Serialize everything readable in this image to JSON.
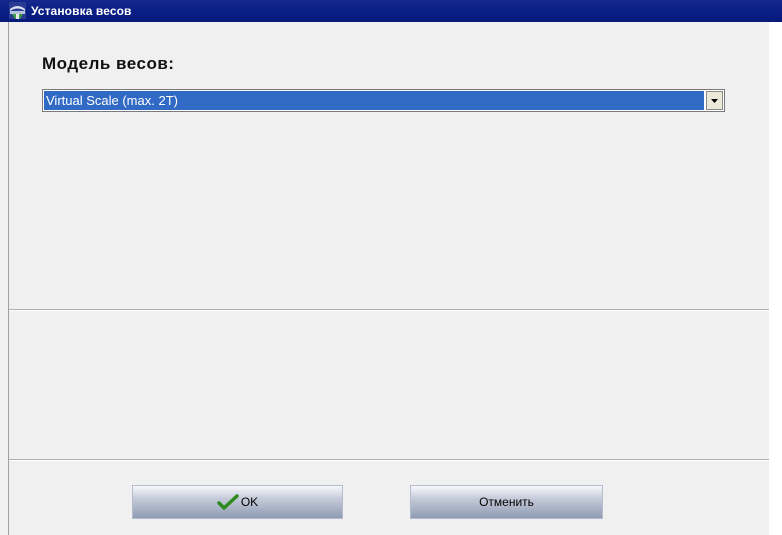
{
  "window": {
    "title": "Установка весов"
  },
  "form": {
    "model_label": "Модель весов:",
    "model_select": {
      "selected": "Virtual Scale (max. 2T)"
    }
  },
  "buttons": {
    "ok_label": "OK",
    "cancel_label": "Отменить"
  },
  "icons": {
    "app": "scale-app-icon",
    "dropdown": "chevron-down-icon",
    "ok": "checkmark-icon"
  },
  "colors": {
    "titlebar": "#0a1f86",
    "selection": "#316ac5",
    "checkmark": "#2e8b1e"
  }
}
